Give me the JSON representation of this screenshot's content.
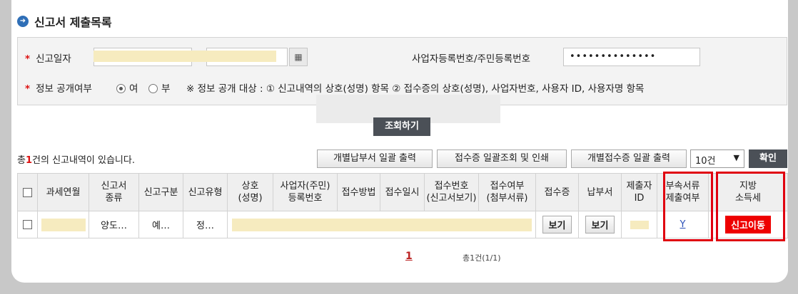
{
  "header": {
    "title": "신고서 제출목록"
  },
  "search": {
    "date_label": "신고일자",
    "biz_label": "사업자등록번호/주민등록번호",
    "biz_value": "••••••••••••••",
    "public_label": "정보 공개여부",
    "radio_yes": "여",
    "radio_no": "부",
    "radio_selected": "여",
    "public_note": "※ 정보 공개 대상 : ① 신고내역의 상호(성명) 항목 ② 접수증의 상호(성명), 사업자번호, 사용자 ID, 사용자명 항목",
    "search_button": "조회하기"
  },
  "toolbar": {
    "count_prefix": "총",
    "count": "1",
    "count_suffix": "건의 신고내역이 있습니다.",
    "btn_print_tax": "개별납부서 일괄 출력",
    "btn_receipt_all": "접수증 일괄조회 및 인쇄",
    "btn_receipt_print": "개별접수증 일괄 출력",
    "page_size": "10건",
    "confirm": "확인"
  },
  "table": {
    "headers": [
      "과세연월",
      "신고서\n종류",
      "신고구분",
      "신고유형",
      "상호\n(성명)",
      "사업자(주민)\n등록번호",
      "접수방법",
      "접수일시",
      "접수번호\n(신고서보기)",
      "접수여부\n(첨부서류)",
      "접수증",
      "납부서",
      "제출자\nID",
      "부속서류\n제출여부",
      "지방\n소득세"
    ],
    "row": {
      "type": "양도…",
      "division": "예…",
      "kind": "정…",
      "receipt": "보기",
      "payment": "보기",
      "attach": "Y",
      "local_tax": "신고이동"
    }
  },
  "pagination": {
    "current": "1",
    "info": "총1건(1/1)"
  }
}
